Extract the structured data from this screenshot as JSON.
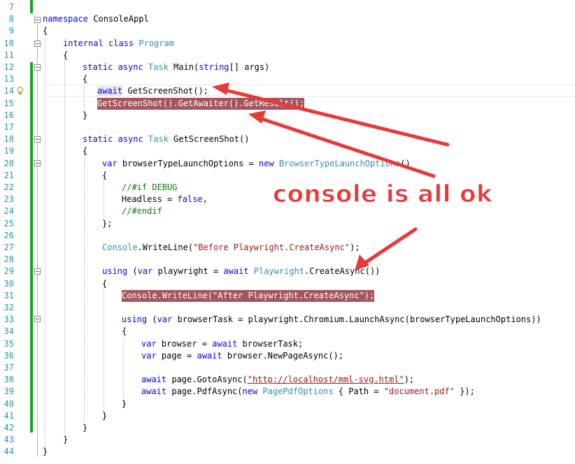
{
  "editor": {
    "line_numbers": [
      "7",
      "8",
      "9",
      "10",
      "11",
      "12",
      "13",
      "14",
      "15",
      "16",
      "17",
      "18",
      "19",
      "20",
      "21",
      "22",
      "23",
      "24",
      "25",
      "26",
      "27",
      "28",
      "29",
      "30",
      "31",
      "32",
      "33",
      "34",
      "35",
      "36",
      "37",
      "38",
      "39",
      "40",
      "41",
      "42",
      "43",
      "44"
    ],
    "lines": {
      "l8": {
        "kw1": "namespace",
        "t1": " ConsoleAppl"
      },
      "l9": {
        "t1": "{"
      },
      "l10": {
        "kw1": "internal class",
        "t1": " Program"
      },
      "l11": {
        "t1": "{"
      },
      "l12": {
        "kw1": "static async",
        "ty1": " Task",
        "t1": " Main(",
        "kw2": "string",
        "t2": "[] args)"
      },
      "l13": {
        "t1": "{"
      },
      "l14": {
        "kw1": "await",
        "t1": " GetScreenShot();"
      },
      "l15": {
        "t1": "GetScreenShot().GetAwaiter().GetResult();"
      },
      "l16": {
        "t1": "}"
      },
      "l18": {
        "kw1": "static async",
        "ty1": " Task",
        "t1": " GetScreenShot()"
      },
      "l19": {
        "t1": "{"
      },
      "l20": {
        "kw1": "var",
        "t1": " browserTypeLaunchOptions = ",
        "kw2": "new",
        "ty1": " BrowserTypeLaunchOptions",
        "t2": "()"
      },
      "l21": {
        "t1": "{"
      },
      "l22": {
        "cm1": "//#if DEBUG"
      },
      "l23": {
        "t1": "Headless = ",
        "kw1": "false",
        "t2": ","
      },
      "l24": {
        "cm1": "//#endif"
      },
      "l25": {
        "t1": "};"
      },
      "l27": {
        "ty1": "Console",
        "t1": ".WriteLine(",
        "str1": "\"Before Playwright.CreateAsync\"",
        "t2": ");"
      },
      "l29": {
        "kw1": "using",
        "t1": " (",
        "kw2": "var",
        "t2": " playwright = ",
        "kw3": "await",
        "ty1": " Playwright",
        "t3": ".CreateAsync())"
      },
      "l30": {
        "t1": "{"
      },
      "l31": {
        "t1": "Console.WriteLine(\"After Playwright.CreateAsync\");"
      },
      "l33": {
        "kw1": "using",
        "t1": " (",
        "kw2": "var",
        "t2": " browserTask = playwright.Chromium.LaunchAsync(browserTypeLaunchOptions))"
      },
      "l34": {
        "t1": "{"
      },
      "l35": {
        "kw1": "var",
        "t1": " browser = ",
        "kw2": "await",
        "t2": " browserTask;"
      },
      "l36": {
        "kw1": "var",
        "t1": " page = ",
        "kw2": "await",
        "t2": " browser.NewPageAsync();"
      },
      "l38": {
        "kw1": "await",
        "t1": " page.GotoAsync(",
        "str1": "\"http://localhost/mml-svg.html\"",
        "t2": ");"
      },
      "l39": {
        "kw1": "await",
        "t1": " page.PdfAsync(",
        "kw2": "new",
        "ty1": " PagePdfOptions",
        "t2": " { Path = ",
        "str1": "\"document.pdf\"",
        "t3": " });"
      },
      "l40": {
        "t1": "}"
      },
      "l41": {
        "t1": "}"
      },
      "l42": {
        "t1": "}"
      },
      "l43": {
        "t1": "}"
      },
      "l44": {
        "t1": "}"
      }
    }
  },
  "annotation": {
    "text": "console is all ok",
    "color": "#e8393a"
  },
  "colors": {
    "keyword": "#0000ff",
    "type": "#2b91af",
    "string": "#a31515",
    "comment": "#008000",
    "highlight": "#a4565c",
    "change_bar": "#1e9e1e"
  }
}
